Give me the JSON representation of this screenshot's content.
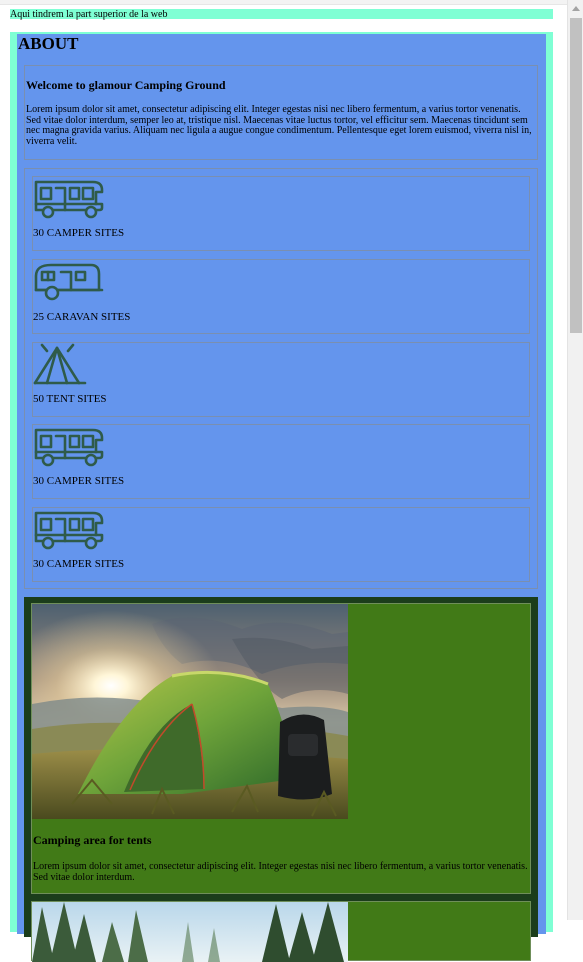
{
  "header": {
    "text": "Aqui tindrem la part superior de la web"
  },
  "about": {
    "title": "ABOUT",
    "welcome_title": "Welcome to glamour Camping Ground",
    "welcome_text": "Lorem ipsum dolor sit amet, consectetur adipiscing elit. Integer egestas nisi nec libero fermentum, a varius tortor venenatis. Sed vitae dolor interdum, semper leo at, tristique nisl. Maecenas vitae luctus tortor, vel efficitur sem. Maecenas tincidunt sem nec magna gravida varius. Aliquam nec ligula a augue congue condimentum. Pellentesque eget lorem euismod, viverra nisl in, viverra velit."
  },
  "sites": [
    {
      "icon": "camper-van-icon",
      "label": "30 CAMPER SITES"
    },
    {
      "icon": "caravan-icon",
      "label": "25 CARAVAN SITES"
    },
    {
      "icon": "tent-icon",
      "label": "50 TENT SITES"
    },
    {
      "icon": "camper-van-icon",
      "label": "30 CAMPER SITES"
    },
    {
      "icon": "camper-van-icon",
      "label": "30 CAMPER SITES"
    }
  ],
  "gallery": [
    {
      "image": "tent-at-sunset-photo",
      "title": "Camping area for tents",
      "text": "Lorem ipsum dolor sit amet, consectetur adipiscing elit. Integer egestas nisi nec libero fermentum, a varius tortor venenatis. Sed vitae dolor interdum."
    },
    {
      "image": "forest-camp-photo"
    }
  ],
  "colors": {
    "header_bg": "#7fffd4",
    "about_bg": "#6495ed",
    "icon_stroke": "#2f5b4a",
    "gallery_bg": "#1b3d1b",
    "card_bg": "#417a17"
  }
}
